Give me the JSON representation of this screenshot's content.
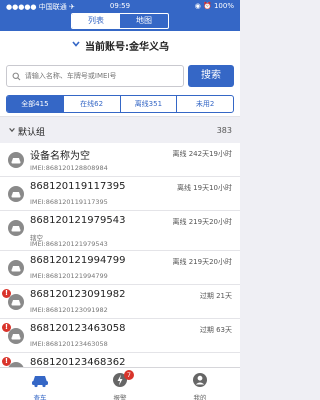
{
  "status": {
    "carrier": "●●●●● 中国联通 ✈",
    "time": "09:59",
    "right": "◉ ⏰ 100%"
  },
  "topnav": {
    "tabs": [
      "列表",
      "地图"
    ]
  },
  "account": {
    "label": "当前账号:金华义乌"
  },
  "search": {
    "placeholder": "请输入名称、车牌号或IMEI号",
    "value": "",
    "button": "搜索"
  },
  "filters": [
    {
      "label": "全部415",
      "active": true
    },
    {
      "label": "在线62",
      "active": false
    },
    {
      "label": "离线351",
      "active": false
    },
    {
      "label": "未用2",
      "active": false
    }
  ],
  "group": {
    "name": "默认组",
    "count": "383"
  },
  "devices": [
    {
      "name": "设备名称为空",
      "imei": "IMEI:868120128808984",
      "status": "离线 242天19小时",
      "alert": false
    },
    {
      "name": "868120119117395",
      "imei": "IMEI:868120119117395",
      "status": "离线 19天10小时",
      "alert": false
    },
    {
      "name": "868120121979543",
      "plate": "辖空",
      "imei": "IMEI:868120121979543",
      "status": "离线 219天20小时",
      "alert": false
    },
    {
      "name": "868120121994799",
      "imei": "IMEI:868120121994799",
      "status": "离线 219天20小时",
      "alert": false
    },
    {
      "name": "868120123091982",
      "imei": "IMEI:868120123091982",
      "status": "过期 21天",
      "alert": true
    },
    {
      "name": "868120123463058",
      "imei": "IMEI:868120123463058",
      "status": "过期 63天",
      "alert": true
    },
    {
      "name": "868120123468362",
      "imei": "",
      "status": "",
      "alert": true
    }
  ],
  "tabbar": [
    {
      "label": "查车",
      "icon": "car-icon",
      "active": true
    },
    {
      "label": "报警",
      "icon": "alarm-icon",
      "badge": "7",
      "active": false
    },
    {
      "label": "我的",
      "icon": "profile-icon",
      "active": false
    }
  ],
  "colors": {
    "primary": "#3567c6",
    "alert": "#d9342b",
    "background": "#efeff4"
  }
}
